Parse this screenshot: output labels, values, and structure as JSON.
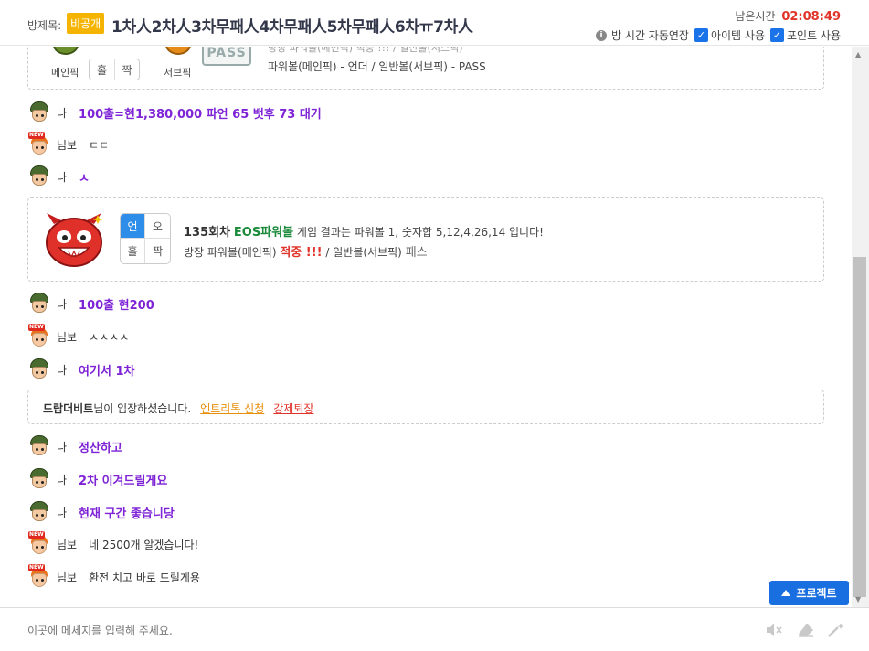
{
  "header": {
    "room_label": "방제목:",
    "private_badge": "비공개",
    "title": "1차人2차人3차무패人4차무패人5차무패人6차ㅠ7차人",
    "remaining_label": "남은시간",
    "remaining_time": "02:08:49",
    "info_icon": "info-icon",
    "auto_extend_label": "방 시간 자동연장",
    "item_label": "아이템 사용",
    "point_label": "포인트 사용",
    "item_checked": true,
    "point_checked": true
  },
  "top_card": {
    "main_pick_label": "메인픽",
    "sub_pick_label": "서브픽",
    "even": "홀",
    "odd": "짝",
    "pass_logo": "PASS",
    "cut_text": "방장 파워볼(메인픽) 적중 !!! / 일반볼(서브픽)",
    "result_text": "파워볼(메인픽) - 언더 / 일반볼(서브픽) - PASS"
  },
  "messages": [
    {
      "avatar": "soldier-avatar",
      "nick": "나",
      "text": "100출=현1,380,000 파언 65 뱃후 73 대기",
      "style": "bold"
    },
    {
      "avatar": "new-avatar",
      "nick": "님보",
      "text": "ㄷㄷ",
      "style": "plain"
    },
    {
      "avatar": "soldier-avatar",
      "nick": "나",
      "text": "ㅅ",
      "style": "bold"
    }
  ],
  "result_card": {
    "grid": [
      "언",
      "오",
      "홀",
      "짝"
    ],
    "round": "135회차",
    "game": "EOS파워볼",
    "result_desc": "게임 결과는 파워볼 1, 숫자합 5,12,4,26,14 입니다!",
    "line2_a": "방장 파워볼(메인픽)",
    "hit": "적중 !!!",
    "line2_b": "/ 일반볼(서브픽)",
    "pass": "패스"
  },
  "messages2": [
    {
      "avatar": "soldier-avatar",
      "nick": "나",
      "text": "100출 현200",
      "style": "bold"
    },
    {
      "avatar": "new-avatar",
      "nick": "님보",
      "text": "ㅅㅅㅅㅅ",
      "style": "plain"
    },
    {
      "avatar": "soldier-avatar",
      "nick": "나",
      "text": "여기서 1차",
      "style": "bold"
    }
  ],
  "enter_card": {
    "user": "드랍더비트",
    "suffix": "님이 입장하셨습니다.",
    "entry_link": "엔트리톡 신청",
    "kick_link": "강제퇴장"
  },
  "messages3": [
    {
      "avatar": "soldier-avatar",
      "nick": "나",
      "text": "정산하고",
      "style": "bold"
    },
    {
      "avatar": "soldier-avatar",
      "nick": "나",
      "text": "2차 이겨드릴게요",
      "style": "bold"
    },
    {
      "avatar": "soldier-avatar",
      "nick": "나",
      "text": "현재 구간 좋습니당",
      "style": "bold"
    },
    {
      "avatar": "new-avatar",
      "nick": "님보",
      "text": "네 2500개 알겠습니다!",
      "style": "plain"
    },
    {
      "avatar": "new-avatar",
      "nick": "님보",
      "text": "환전 치고 바로 드릴게용",
      "style": "plain"
    }
  ],
  "project_button": "프로젝트",
  "input": {
    "placeholder": "이곳에 메세지를 입력해 주세요.",
    "value": ""
  },
  "tools": [
    "mute-icon",
    "eraser-icon",
    "magic-wand-icon"
  ],
  "colors": {
    "accent": "#1a73e8",
    "message": "#7e24d6",
    "hit": "#e0342b",
    "game": "#1b8a3a",
    "badge": "#f5b400"
  }
}
